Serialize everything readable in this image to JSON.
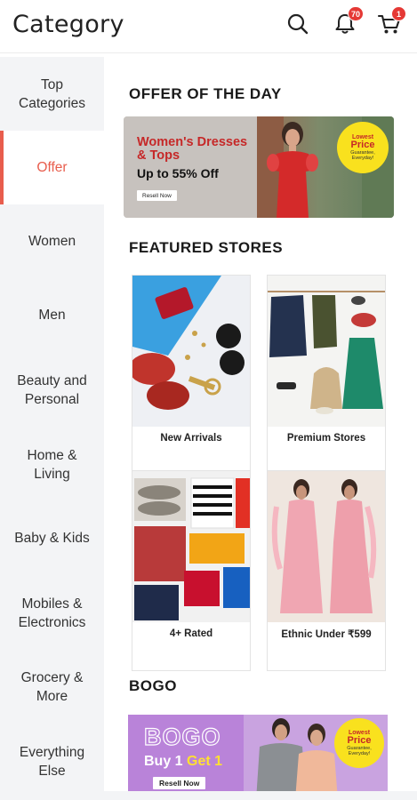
{
  "header": {
    "title": "Category",
    "notification_count": "70",
    "cart_count": "1"
  },
  "sidebar": {
    "items": [
      {
        "label": "Top\nCategories"
      },
      {
        "label": "Offer"
      },
      {
        "label": "Women"
      },
      {
        "label": "Men"
      },
      {
        "label": "Beauty and\nPersonal"
      },
      {
        "label": "Home &\nLiving"
      },
      {
        "label": "Baby & Kids"
      },
      {
        "label": "Mobiles &\nElectronics"
      },
      {
        "label": "Grocery &\nMore"
      },
      {
        "label": "Everything\nElse"
      }
    ],
    "active_index": 1
  },
  "offer_of_the_day": {
    "title": "OFFER OF THE DAY",
    "banner": {
      "headline_1": "Women's Dresses",
      "headline_2": "& Tops",
      "subline": "Up to 55% Off",
      "button": "Resell Now",
      "seal_1": "Lowest",
      "seal_2": "Price",
      "seal_3": "Guarantee,",
      "seal_4": "Everyday!"
    }
  },
  "featured_stores": {
    "title": "FEATURED STORES",
    "stores": [
      {
        "label": "New Arrivals"
      },
      {
        "label": "Premium Stores"
      },
      {
        "label": "4+ Rated"
      },
      {
        "label": "Ethnic Under ₹599"
      }
    ]
  },
  "bogo": {
    "title": "BOGO",
    "banner": {
      "big": "BOGO",
      "line_a": "Buy 1 ",
      "line_b": "Get 1",
      "button": "Resell Now",
      "seal_1": "Lowest",
      "seal_2": "Price",
      "seal_3": "Guarantee,",
      "seal_4": "Everyday!"
    }
  },
  "colors": {
    "accent": "#e85d4d",
    "sidebar_bg": "#f3f4f6",
    "badge": "#e53935"
  }
}
